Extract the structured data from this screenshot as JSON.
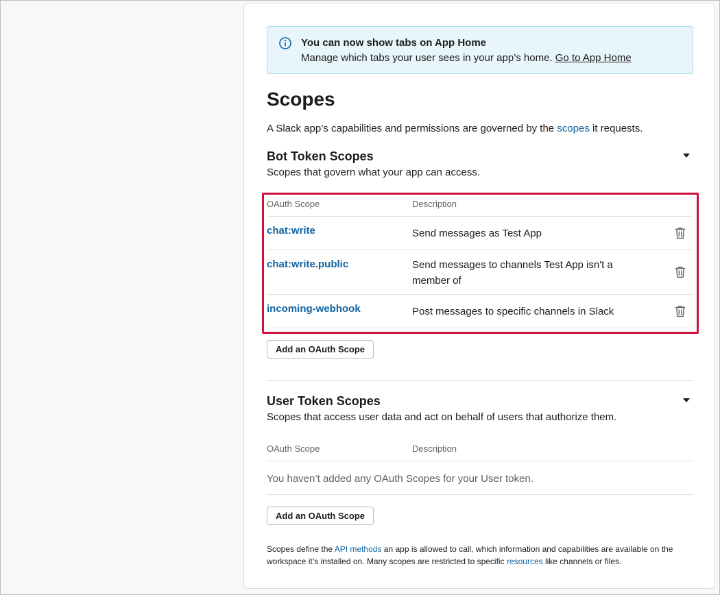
{
  "banner": {
    "title": "You can now show tabs on App Home",
    "text": "Manage which tabs your user sees in your app’s home. ",
    "link": "Go to App Home"
  },
  "page": {
    "title": "Scopes",
    "intro_before": "A Slack app’s capabilities and permissions are governed by the ",
    "intro_link": "scopes",
    "intro_after": " it requests."
  },
  "bot": {
    "title": "Bot Token Scopes",
    "subtitle": "Scopes that govern what your app can access.",
    "col_scope": "OAuth Scope",
    "col_desc": "Description",
    "rows": [
      {
        "scope": "chat:write",
        "desc": "Send messages as Test App"
      },
      {
        "scope": "chat:write.public",
        "desc": "Send messages to channels Test App isn't a member of"
      },
      {
        "scope": "incoming-webhook",
        "desc": "Post messages to specific channels in Slack"
      }
    ],
    "add_button": "Add an OAuth Scope"
  },
  "user": {
    "title": "User Token Scopes",
    "subtitle": "Scopes that access user data and act on behalf of users that authorize them.",
    "col_scope": "OAuth Scope",
    "col_desc": "Description",
    "empty": "You haven’t added any OAuth Scopes for your User token.",
    "add_button": "Add an OAuth Scope"
  },
  "footer": {
    "t1": "Scopes define the ",
    "link1": "API methods",
    "t2": " an app is allowed to call, which information and capabilities are available on the workspace it’s installed on. Many scopes are restricted to specific ",
    "link2": "resources",
    "t3": " like channels or files."
  },
  "colors": {
    "link": "#1264a3",
    "highlight": "#d0103a",
    "banner_bg": "#e8f5fa"
  },
  "icons": {
    "info": "info-circle-icon",
    "trash": "trash-icon",
    "caret": "caret-down-icon"
  }
}
